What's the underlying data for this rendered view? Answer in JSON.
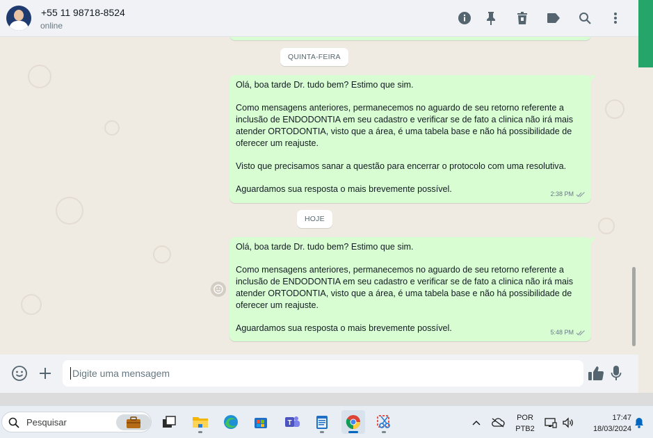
{
  "header": {
    "contact_name": "+55 11 98718-8524",
    "status": "online",
    "icons": [
      "info-icon",
      "pin-icon",
      "trash-icon",
      "label-icon",
      "search-icon",
      "more-vertical-icon"
    ]
  },
  "chat": {
    "date_separators": [
      "QUINTA-FEIRA",
      "HOJE"
    ],
    "messages": [
      {
        "paragraphs": [
          "Olá, boa tarde Dr. tudo bem? Estimo que sim.",
          "Como mensagens anteriores, permanecemos no aguardo de seu retorno referente a inclusão de ENDODONTIA em seu cadastro e verificar se de fato a clinica não irá mais atender ORTODONTIA, visto que a área, é uma tabela base e não há possibilidade de oferecer um reajuste.",
          "Visto que precisamos sanar a questão para encerrar o protocolo com uma resolutiva.",
          "Aguardamos sua resposta o mais brevemente possível."
        ],
        "time": "2:38 PM",
        "status": "read"
      },
      {
        "paragraphs": [
          "Olá, boa tarde Dr. tudo bem? Estimo que sim.",
          "Como mensagens anteriores, permanecemos no aguardo de seu retorno referente a inclusão de ENDODONTIA em seu cadastro e verificar se de fato a clinica não irá mais atender ORTODONTIA, visto que a área, é uma tabela base e não há possibilidade de oferecer um reajuste.",
          "Aguardamos sua resposta o mais brevemente possível."
        ],
        "time": "5:48 PM",
        "status": "read"
      }
    ]
  },
  "composer": {
    "placeholder": "Digite uma mensagem"
  },
  "taskbar": {
    "search_label": "Pesquisar",
    "apps": [
      "task-view",
      "file-explorer",
      "edge",
      "store",
      "teams",
      "notepad",
      "chrome",
      "snipping-tool"
    ],
    "active_app": "chrome",
    "language": "POR",
    "keyboard": "PTB2",
    "time": "17:47",
    "date": "18/03/2024"
  },
  "colors": {
    "outgoing_bubble": "#d9fdd3",
    "chat_background": "#efeae2",
    "header_background": "#f0f2f5",
    "accent_green": "#25a56a",
    "chrome_active": "#0067c0"
  }
}
